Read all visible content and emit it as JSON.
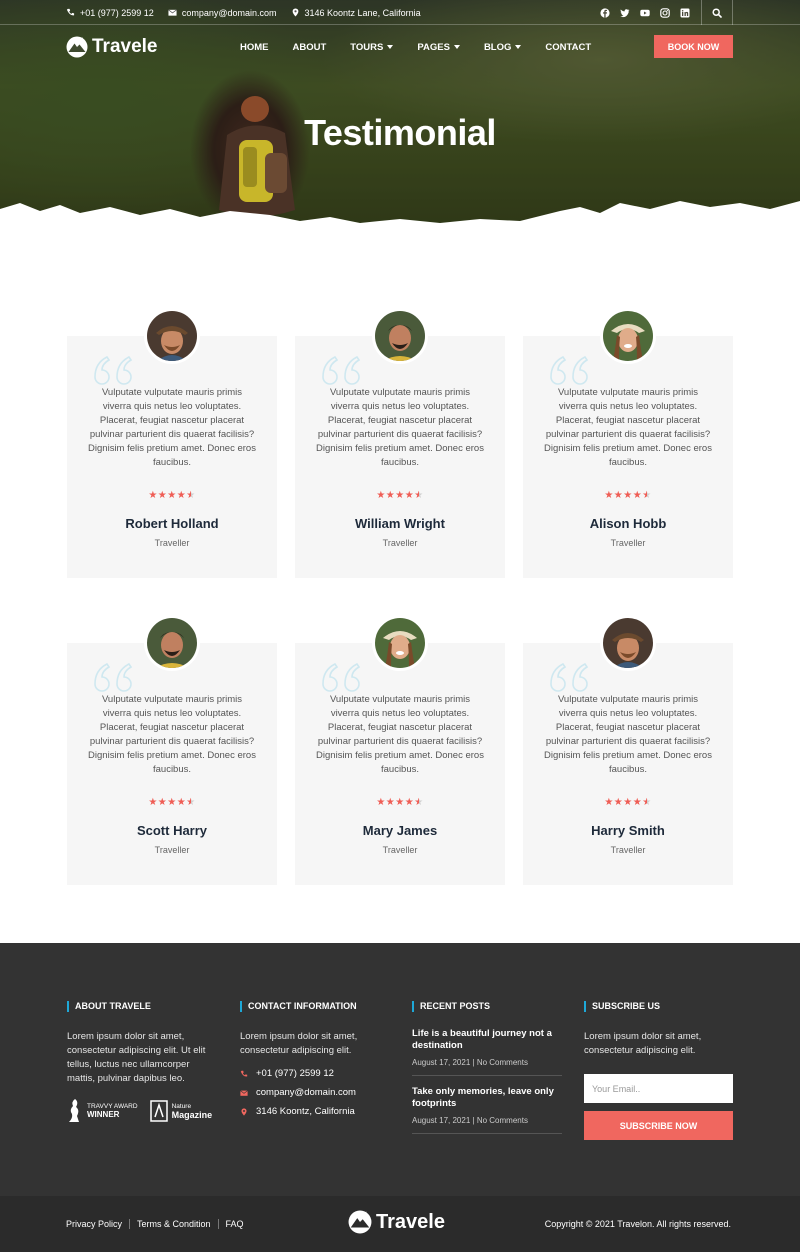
{
  "topbar": {
    "phone": "+01 (977) 2599 12",
    "email": "company@domain.com",
    "address": "3146 Koontz Lane, California",
    "socials": [
      "facebook-icon",
      "twitter-icon",
      "youtube-icon",
      "instagram-icon",
      "linkedin-icon"
    ]
  },
  "nav": {
    "logo": "Travele",
    "items": [
      {
        "label": "HOME"
      },
      {
        "label": "ABOUT"
      },
      {
        "label": "TOURS"
      },
      {
        "label": "PAGES"
      },
      {
        "label": "BLOG"
      },
      {
        "label": "CONTACT"
      }
    ],
    "book_label": "BOOK NOW"
  },
  "hero": {
    "title": "Testimonial"
  },
  "testimonials": [
    {
      "text": "Vulputate vulputate mauris primis viverra quis netus leo voluptates. Placerat, feugiat nascetur placerat pulvinar parturient dis quaerat facilisis? Dignisim felis pretium amet. Donec eros faucibus.",
      "name": "Robert Holland",
      "role": "Traveller",
      "rating": 4.5
    },
    {
      "text": "Vulputate vulputate mauris primis viverra quis netus leo voluptates. Placerat, feugiat nascetur placerat pulvinar parturient dis quaerat facilisis? Dignisim felis pretium amet. Donec eros faucibus.",
      "name": "William Wright",
      "role": "Traveller",
      "rating": 4.5
    },
    {
      "text": "Vulputate vulputate mauris primis viverra quis netus leo voluptates. Placerat, feugiat nascetur placerat pulvinar parturient dis quaerat facilisis? Dignisim felis pretium amet. Donec eros faucibus.",
      "name": "Alison Hobb",
      "role": "Traveller",
      "rating": 4.5
    },
    {
      "text": "Vulputate vulputate mauris primis viverra quis netus leo voluptates. Placerat, feugiat nascetur placerat pulvinar parturient dis quaerat facilisis? Dignisim felis pretium amet. Donec eros faucibus.",
      "name": "Scott Harry",
      "role": "Traveller",
      "rating": 4.5
    },
    {
      "text": "Vulputate vulputate mauris primis viverra quis netus leo voluptates. Placerat, feugiat nascetur placerat pulvinar parturient dis quaerat facilisis? Dignisim felis pretium amet. Donec eros faucibus.",
      "name": "Mary James",
      "role": "Traveller",
      "rating": 4.5
    },
    {
      "text": "Vulputate vulputate mauris primis viverra quis netus leo voluptates. Placerat, feugiat nascetur placerat pulvinar parturient dis quaerat facilisis? Dignisim felis pretium amet. Donec eros faucibus.",
      "name": "Harry Smith",
      "role": "Traveller",
      "rating": 4.5
    }
  ],
  "footer": {
    "about": {
      "heading": "ABOUT TRAVELE",
      "text": "Lorem ipsum dolor sit amet, consectetur adipiscing elit. Ut elit tellus, luctus nec ullamcorper mattis, pulvinar dapibus leo.",
      "award1_line1": "TRAVVY AWARD",
      "award1_line2": "WINNER",
      "award2_line1": "Nature",
      "award2_line2": "Magazine"
    },
    "contact": {
      "heading": "CONTACT INFORMATION",
      "text": "Lorem ipsum dolor sit amet, consectetur adipiscing elit.",
      "phone": "+01 (977) 2599 12",
      "email": "company@domain.com",
      "address": "3146 Koontz, California"
    },
    "posts": {
      "heading": "RECENT POSTS",
      "items": [
        {
          "title": "Life is a beautiful journey not a destination",
          "date": "August 17, 2021",
          "comments": "No Comments"
        },
        {
          "title": "Take only memories, leave only footprints",
          "date": "August 17, 2021",
          "comments": "No Comments"
        }
      ]
    },
    "subscribe": {
      "heading": "SUBSCRIBE US",
      "text": "Lorem ipsum dolor sit amet, consectetur adipiscing elit.",
      "placeholder": "Your Email..",
      "button": "SUBSCRIBE NOW"
    }
  },
  "bottom": {
    "links": [
      "Privacy Policy",
      "Terms & Condition",
      "FAQ"
    ],
    "logo": "Travele",
    "copyright": "Copyright © 2021 Travelon. All rights reserved."
  },
  "colors": {
    "accent": "#f0675f",
    "footer_bg": "#333333",
    "bottom_bg": "#2b2b2b",
    "heading_bar": "#1ea8d7",
    "card_bg": "#f6f6f6"
  }
}
